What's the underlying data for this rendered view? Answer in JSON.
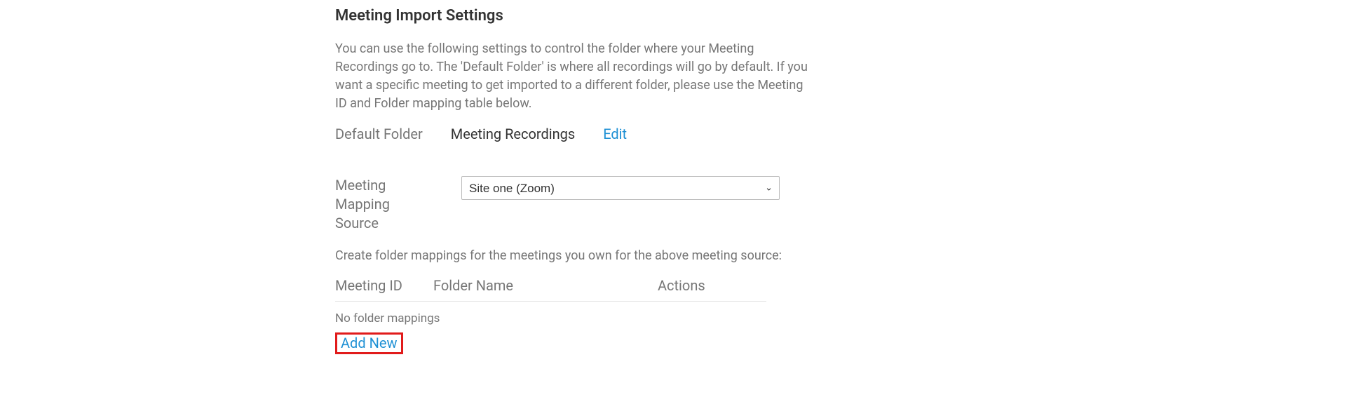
{
  "heading": "Meeting Import Settings",
  "description": "You can use the following settings to control the folder where your Meeting Recordings go to. The 'Default Folder' is where all recordings will go by default. If you want a specific meeting to get imported to a different folder, please use the Meeting ID and Folder mapping table below.",
  "defaultFolder": {
    "label": "Default Folder",
    "value": "Meeting Recordings",
    "editLabel": "Edit"
  },
  "mappingSource": {
    "label": "Meeting Mapping Source",
    "selected": "Site one (Zoom)"
  },
  "mappingInfo": "Create folder mappings for the meetings you own for the above meeting source:",
  "table": {
    "columns": {
      "meetingId": "Meeting ID",
      "folderName": "Folder Name",
      "actions": "Actions"
    },
    "emptyMessage": "No folder mappings"
  },
  "addNewLabel": "Add New"
}
